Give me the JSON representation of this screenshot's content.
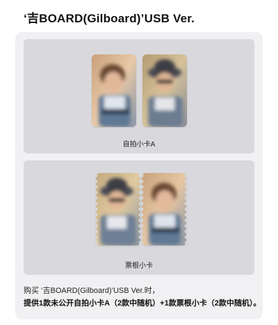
{
  "title": "‘吉BOARD(Gilboard)’USB Ver.",
  "panels": [
    {
      "caption": "自拍小卡A",
      "cards": [
        {
          "icon": "photo-card-selfie-blurred",
          "style": "rounded"
        },
        {
          "icon": "photo-card-hat-blurred",
          "style": "rounded"
        }
      ]
    },
    {
      "caption": "票根小卡",
      "cards": [
        {
          "icon": "ticket-card-hat-blurred",
          "style": "ticket"
        },
        {
          "icon": "ticket-card-selfie-blurred",
          "style": "ticket"
        }
      ]
    }
  ],
  "description": {
    "line1": "购买 ‘吉BOARD(Gilboard)’USB Ver.时，",
    "line2": "提供1款未公开自拍小卡A（2款中随机）+1款票根小卡（2款中随机）。"
  },
  "colors": {
    "outer_card_bg": "#f1f1f3",
    "panel_bg": "#d9d9dd",
    "text": "#111111"
  }
}
